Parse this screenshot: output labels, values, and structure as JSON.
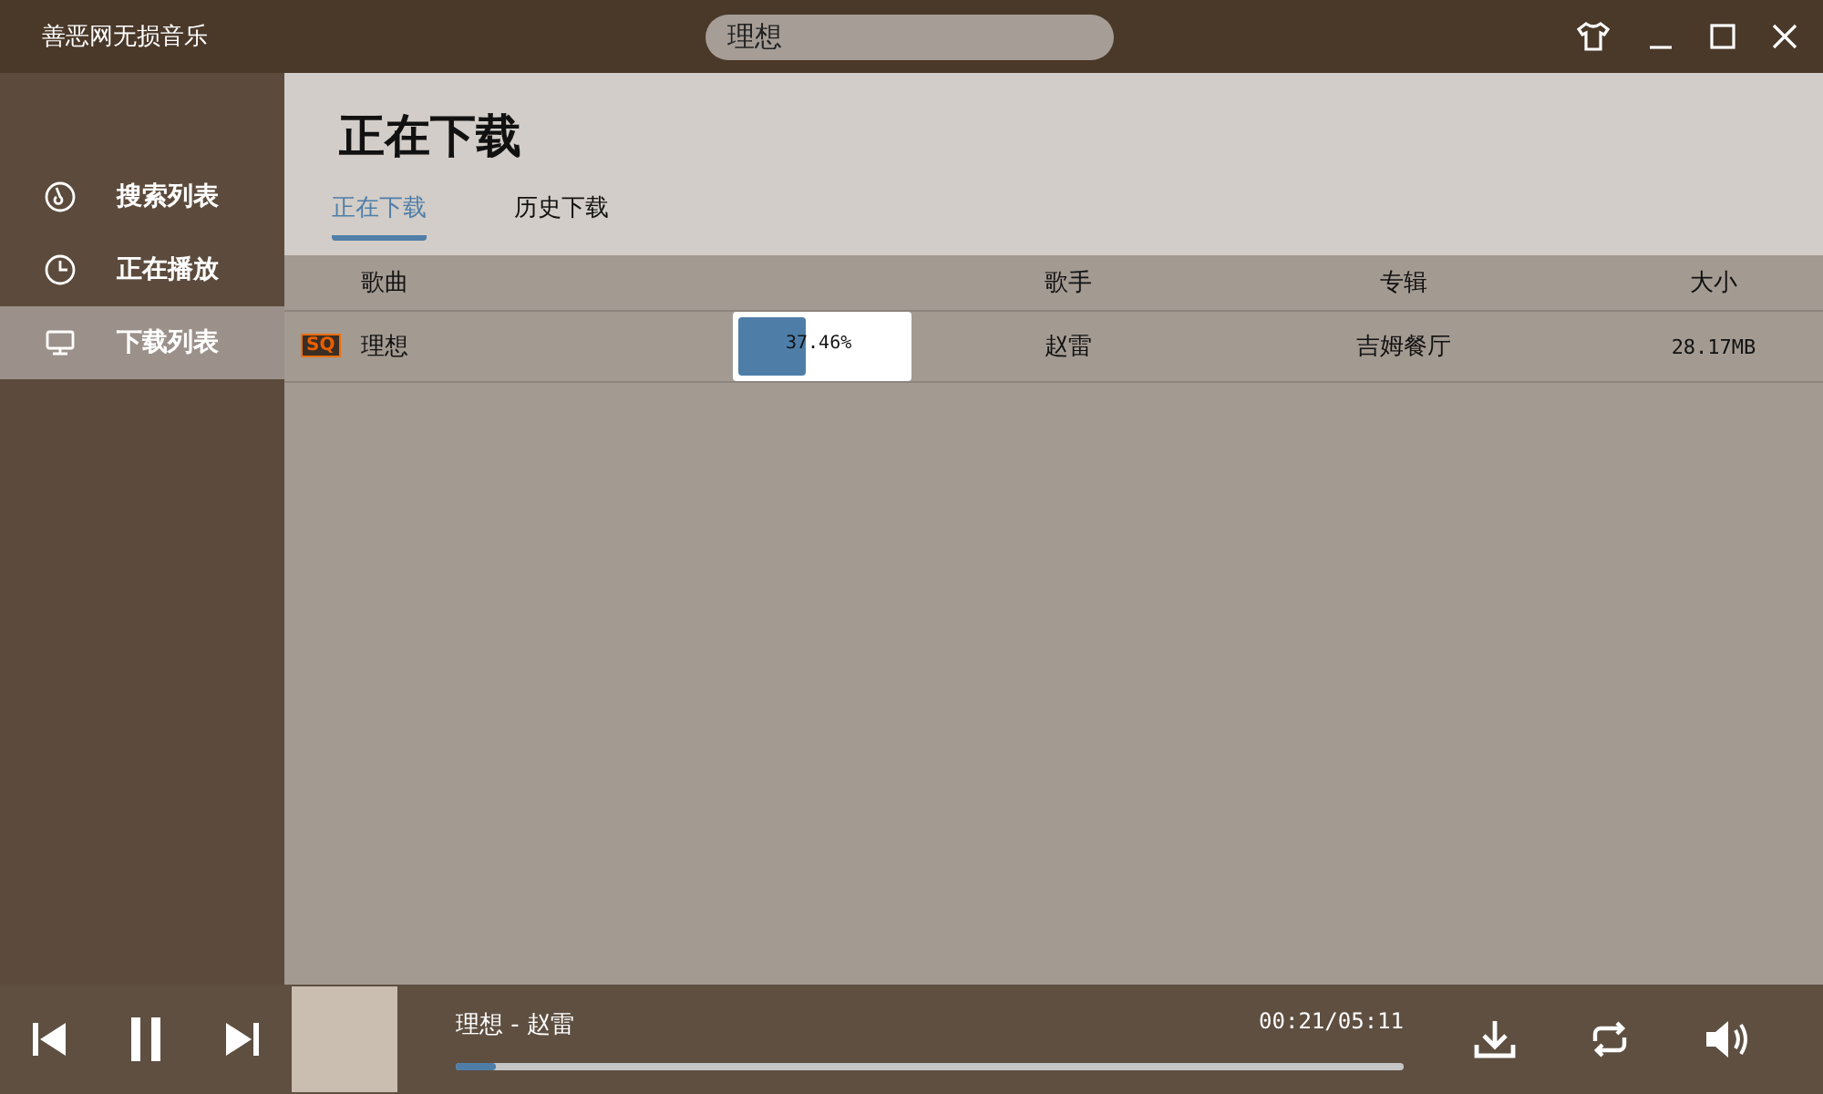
{
  "window": {
    "title": "善恶网无损音乐"
  },
  "search": {
    "value": "理想"
  },
  "sidebar": {
    "items": [
      {
        "label": "搜索列表",
        "selected": false
      },
      {
        "label": "正在播放",
        "selected": false
      },
      {
        "label": "下载列表",
        "selected": true
      }
    ]
  },
  "page": {
    "title": "正在下载"
  },
  "tabs": [
    {
      "label": "正在下载",
      "selected": true
    },
    {
      "label": "历史下载",
      "selected": false
    }
  ],
  "table": {
    "columns": [
      "歌曲",
      "歌手",
      "专辑",
      "大小"
    ],
    "rows": [
      {
        "badge": "SQ",
        "song": "理想",
        "level": 0.3746,
        "progress": "37.46%",
        "artist": "赵雷",
        "album": "吉姆餐厅",
        "size": "28.17MB"
      }
    ]
  },
  "player": {
    "track": "理想 - 赵雷",
    "time": "00:21/05:11",
    "level": 0.042,
    "playing": true
  }
}
